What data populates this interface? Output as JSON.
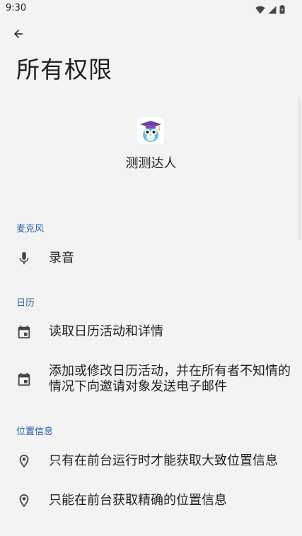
{
  "status_bar": {
    "time": "9:30",
    "icons": [
      "wifi-icon",
      "cellular-signal-icon",
      "battery-icon"
    ]
  },
  "header": {
    "back_icon": "arrow-back-icon",
    "title": "所有权限"
  },
  "app": {
    "name": "测测达人",
    "icon": "owl-graduate-app-icon"
  },
  "sections": {
    "microphone": {
      "title": "麦克风",
      "items": [
        {
          "label": "录音",
          "icon": "microphone-icon"
        }
      ]
    },
    "calendar": {
      "title": "日历",
      "items": [
        {
          "label": "读取日历活动和详情",
          "icon": "calendar-icon"
        },
        {
          "label": "添加或修改日历活动，并在所有者不知情的情况下向邀请对象发送电子邮件",
          "icon": "calendar-icon"
        }
      ]
    },
    "location": {
      "title": "位置信息",
      "items": [
        {
          "label": "只有在前台运行时才能获取大致位置信息",
          "icon": "location-pin-icon"
        },
        {
          "label": "只能在前台获取精确的位置信息",
          "icon": "location-pin-icon"
        }
      ]
    }
  },
  "colors": {
    "background": "#f3f3f3",
    "section_header": "#2a5ca8",
    "text": "#1f1f1f",
    "icon": "#444746"
  }
}
